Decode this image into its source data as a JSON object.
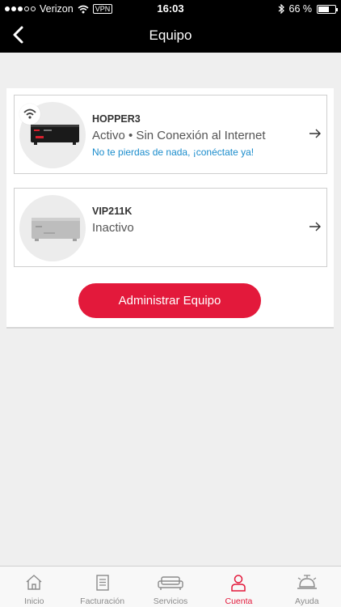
{
  "status_bar": {
    "carrier": "Verizon",
    "vpn": "VPN",
    "time": "16:03",
    "battery": "66 %",
    "battery_level": 0.66
  },
  "header": {
    "title": "Equipo"
  },
  "devices": [
    {
      "name": "HOPPER3",
      "status": "Activo • Sin Conexión al Internet",
      "link": "No te pierdas de nada, ¡conéctate ya!"
    },
    {
      "name": "VIP211K",
      "status": "Inactivo"
    }
  ],
  "manage_button": "Administrar Equipo",
  "tabs": [
    {
      "label": "Inicio",
      "icon": "home-icon"
    },
    {
      "label": "Facturación",
      "icon": "bill-icon"
    },
    {
      "label": "Servicios",
      "icon": "couch-icon"
    },
    {
      "label": "Cuenta",
      "icon": "user-icon",
      "active": true
    },
    {
      "label": "Ayuda",
      "icon": "bell-icon"
    }
  ],
  "colors": {
    "accent": "#e3193b",
    "link": "#1a8ccc",
    "header_bg": "#000000"
  }
}
